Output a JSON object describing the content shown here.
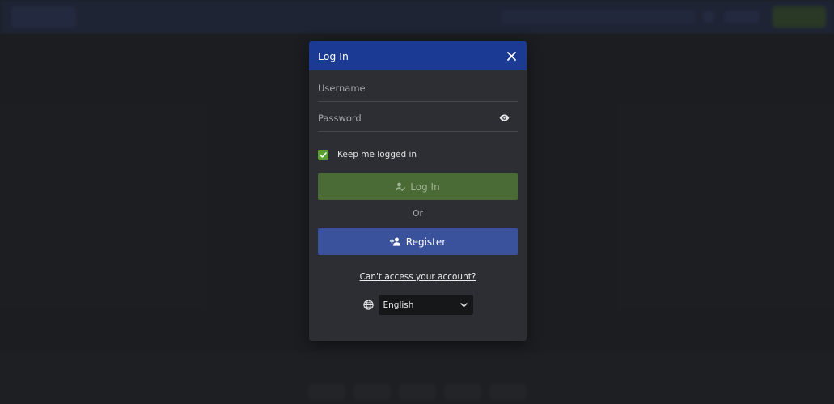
{
  "modal": {
    "title": "Log In",
    "username_placeholder": "Username",
    "password_placeholder": "Password",
    "remember_label": "Keep me logged in",
    "login_label": "Log In",
    "or_label": "Or",
    "register_label": "Register",
    "forgot_label": "Can't access your account?",
    "language_value": "English"
  },
  "colors": {
    "header": "#1a3a94",
    "login_button": "#4a6b35",
    "register_button": "#3a519b",
    "checkbox": "#5aa033"
  },
  "icons": [
    "close-icon",
    "eye-icon",
    "check-icon",
    "user-check-icon",
    "user-plus-icon",
    "globe-icon",
    "chevron-down-icon"
  ]
}
